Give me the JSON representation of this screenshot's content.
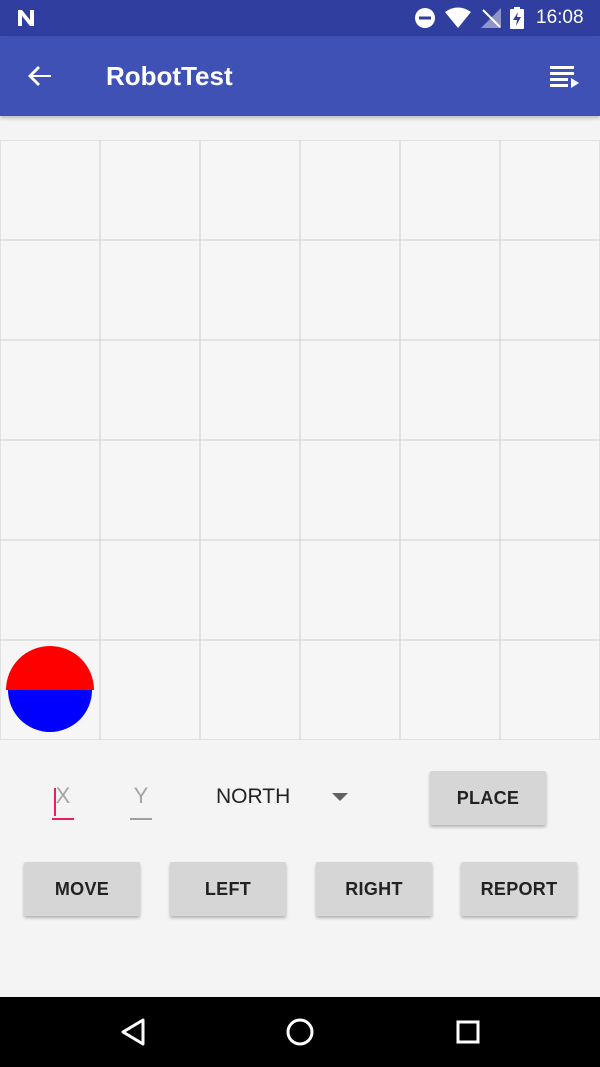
{
  "status_bar": {
    "time": "16:08",
    "icons": [
      "notification-n-icon",
      "do-not-disturb-icon",
      "wifi-icon",
      "no-signal-icon",
      "battery-charging-icon"
    ]
  },
  "app_bar": {
    "title": "RobotTest",
    "back_icon": "arrow-back-icon",
    "menu_icon": "playlist-icon"
  },
  "board": {
    "columns": 6,
    "rows": 6,
    "robot": {
      "column": 0,
      "row": 5,
      "facing": "NORTH",
      "top_color": "#ff0000",
      "bottom_color": "#0000ff"
    }
  },
  "controls": {
    "x_placeholder": "X",
    "y_placeholder": "Y",
    "direction_selected": "NORTH",
    "place_label": "PLACE",
    "move_label": "MOVE",
    "left_label": "LEFT",
    "right_label": "RIGHT",
    "report_label": "REPORT"
  },
  "colors": {
    "primary": "#3f51b5",
    "primary_dark": "#303f9f",
    "accent": "#e91e63"
  },
  "nav_bar": {
    "icons": [
      "nav-back-icon",
      "nav-home-icon",
      "nav-recents-icon"
    ]
  }
}
